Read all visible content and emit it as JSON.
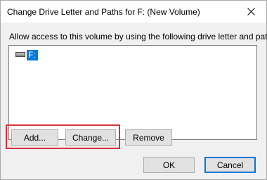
{
  "window": {
    "title": "Change Drive Letter and Paths for F: (New Volume)",
    "close_glyph": "✕"
  },
  "instruction": "Allow access to this volume by using the following drive letter and paths:",
  "paths_list": {
    "items": [
      {
        "icon": "drive-icon",
        "label": "F:",
        "selected": true
      }
    ]
  },
  "buttons": {
    "add": "Add...",
    "change": "Change...",
    "remove": "Remove",
    "ok": "OK",
    "cancel": "Cancel"
  },
  "colors": {
    "selection": "#0078d7",
    "highlight_box": "#d9323c",
    "dialog_background": "#f0f0f0"
  }
}
